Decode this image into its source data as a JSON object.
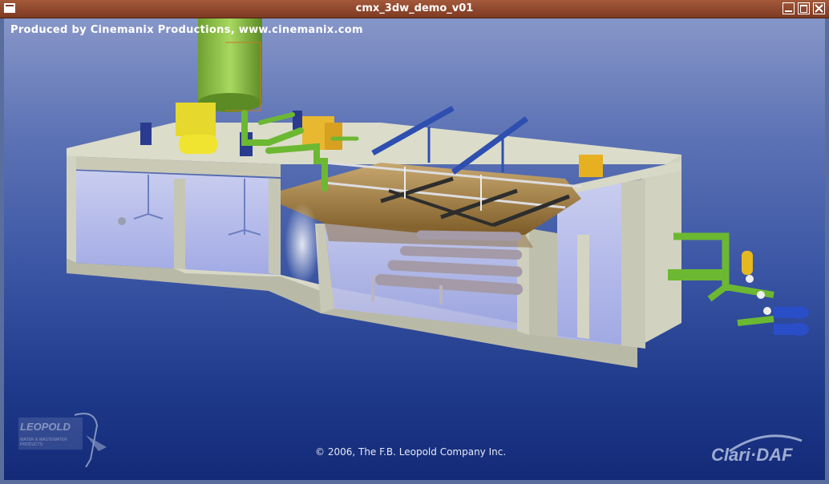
{
  "window": {
    "title": "cmx_3dw_demo_v01",
    "controls": [
      "minimize",
      "maximize",
      "close"
    ]
  },
  "viewport": {
    "credit": "Produced by Cinemanix Productions, www.cinemanix.com",
    "copyright": "© 2006, The F.B. Leopold Company Inc.",
    "logo_left": {
      "name": "LEOPOLD",
      "subtitle": "WATER & WASTEWATER PRODUCTS"
    },
    "logo_right": "Clari·DAF"
  },
  "colors": {
    "titlebar": "#8e4429",
    "concrete": "#d8d8c6",
    "water": "#c8ccf2",
    "pipe": "#6cb832",
    "beam": "#2e4fb0",
    "sludge": "#a07a3c",
    "equipment_yellow": "#e8d830"
  }
}
